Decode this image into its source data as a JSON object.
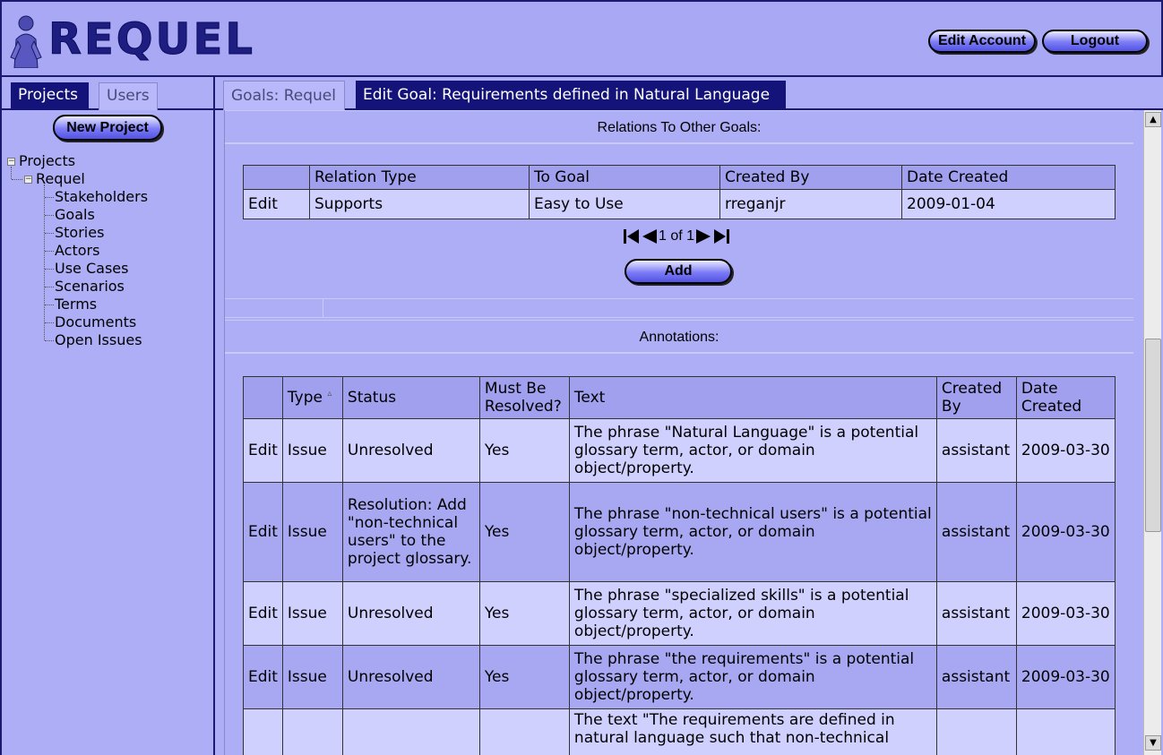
{
  "app": {
    "logo_text": "REQUEL"
  },
  "header": {
    "edit_account_label": "Edit Account",
    "logout_label": "Logout"
  },
  "left": {
    "tabs": [
      {
        "label": "Projects",
        "active": true
      },
      {
        "label": "Users",
        "active": false
      }
    ],
    "new_project_label": "New Project",
    "tree": {
      "root": "Projects",
      "project": "Requel",
      "items": [
        "Stakeholders",
        "Goals",
        "Stories",
        "Actors",
        "Use Cases",
        "Scenarios",
        "Terms",
        "Documents",
        "Open Issues"
      ]
    }
  },
  "main": {
    "tabs": [
      {
        "label": "Goals: Requel",
        "active": false
      },
      {
        "label": "Edit Goal: Requirements defined in Natural Language",
        "active": true
      }
    ],
    "relations": {
      "title": "Relations To Other Goals:",
      "columns": [
        "",
        "Relation Type",
        "To Goal",
        "Created By",
        "Date Created"
      ],
      "rows": [
        [
          "Edit",
          "Supports",
          "Easy to Use",
          "rreganjr",
          "2009-01-04"
        ]
      ],
      "pager": "1 of 1",
      "add_label": "Add"
    },
    "annotations": {
      "title": "Annotations:",
      "columns": [
        "",
        "Type",
        "Status",
        "Must Be Resolved?",
        "Text",
        "Created By",
        "Date Created"
      ],
      "sort_indicator": "▵",
      "rows": [
        [
          "Edit",
          "Issue",
          "Unresolved",
          "Yes",
          "The phrase \"Natural Language\" is a potential glossary term, actor, or domain object/property.",
          "assistant",
          "2009-03-30"
        ],
        [
          "Edit",
          "Issue",
          "Resolution: Add \"non-technical users\" to the project glossary.",
          "Yes",
          "The phrase \"non-technical users\" is a potential glossary term, actor, or domain object/property.",
          "assistant",
          "2009-03-30"
        ],
        [
          "Edit",
          "Issue",
          "Unresolved",
          "Yes",
          "The phrase \"specialized skills\" is a potential glossary term, actor, or domain object/property.",
          "assistant",
          "2009-03-30"
        ],
        [
          "Edit",
          "Issue",
          "Unresolved",
          "Yes",
          "The phrase \"the requirements\" is a potential glossary term, actor, or domain object/property.",
          "assistant",
          "2009-03-30"
        ],
        [
          "",
          "",
          "",
          "",
          "The text \"The requirements are defined in natural language such that non-technical",
          "",
          ""
        ]
      ]
    }
  },
  "colors": {
    "header_bg": "#a8a8f4",
    "active_tab": "#13137a",
    "row_light": "#d0d0ff",
    "row_dark": "#a8a8f2"
  }
}
